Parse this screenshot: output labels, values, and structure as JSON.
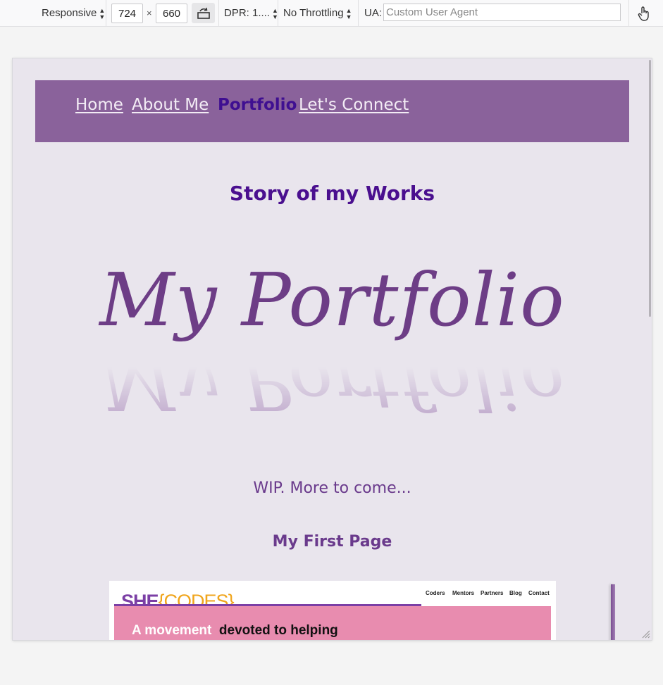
{
  "toolbar": {
    "device": "Responsive",
    "width": "724",
    "times": "×",
    "height": "660",
    "dpr": "DPR: 1....",
    "throttling": "No Throttling",
    "ua_label": "UA:",
    "ua_placeholder": "Custom User Agent",
    "icons": [
      "rotate-icon",
      "touch-icon",
      "caret-icon"
    ]
  },
  "page": {
    "nav": {
      "items": [
        {
          "label": "Home"
        },
        {
          "label": "About Me"
        },
        {
          "label": "Portfolio",
          "active": true
        },
        {
          "label": "Let's Connect"
        }
      ]
    },
    "heading": "Story of my Works",
    "portfolio_title": "My Portfolio",
    "wip": "WIP. More to come...",
    "first_page_heading": "My First Page",
    "preview": {
      "logo_she": "SHE",
      "logo_codes": "{CODES}",
      "nav": [
        "Coders",
        "Mentors",
        "Partners",
        "Blog",
        "Contact"
      ],
      "banner_white": "A movement",
      "banner_black": "devoted to helping"
    }
  },
  "colors": {
    "nav_bg": "#8a629b",
    "page_bg": "#e9e5ed",
    "accent_dark": "#4a0f8f",
    "accent_purple": "#6a3a8c",
    "banner_pink": "#e88caf"
  }
}
